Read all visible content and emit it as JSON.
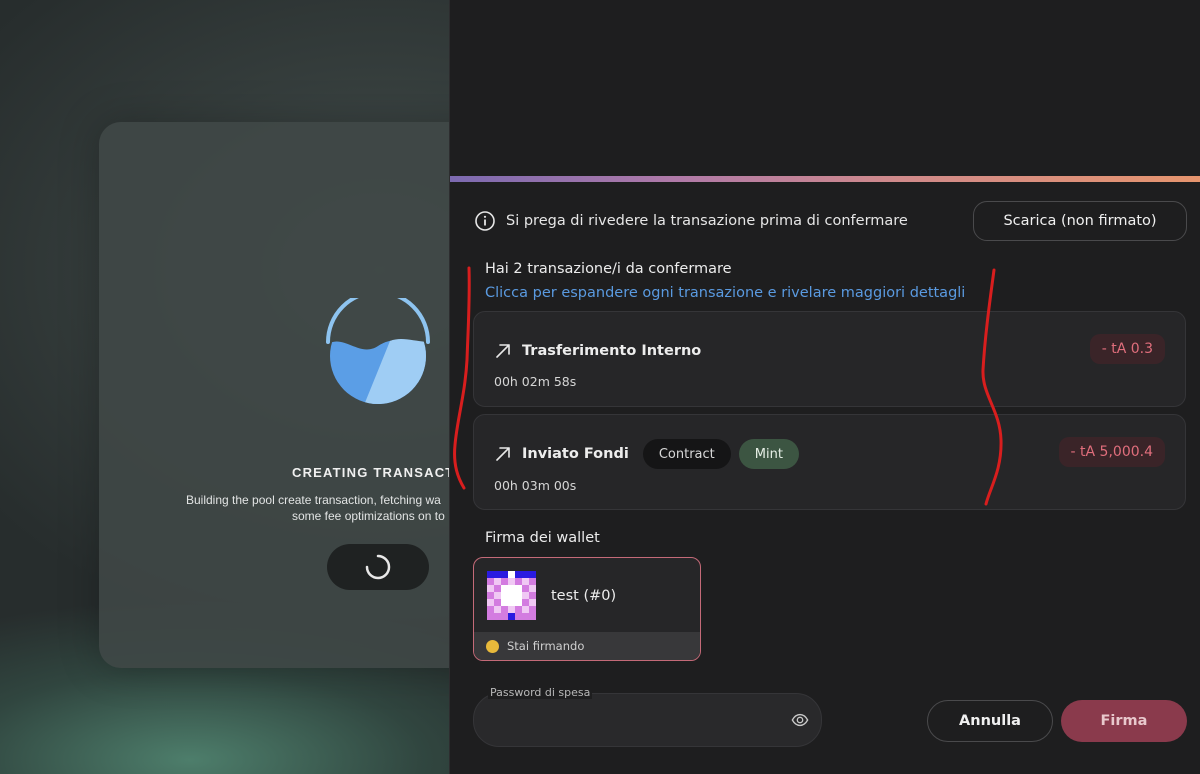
{
  "background_modal": {
    "title": "CREATING TRANSACTIO",
    "description_line1": "Building the pool create transaction, fetching wa",
    "description_line2": "some fee optimizations on to",
    "spinner_icon": "spinner-icon",
    "logo_icon": "water-bowl-logo"
  },
  "review": {
    "info_text": "Si prega di rivedere la transazione prima di confermare",
    "download_label": "Scarica (non firmato)",
    "heading": "Hai 2 transazione/i da confermare",
    "expand_link": "Clicca per espandere ogni transazione e rivelare maggiori dettagli"
  },
  "transactions": [
    {
      "title": "Trasferimento Interno",
      "time": "00h 02m 58s",
      "amount": "- tA 0.3",
      "tags": []
    },
    {
      "title": "Inviato Fondi",
      "time": "00h 03m 00s",
      "amount": "- tA 5,000.4",
      "tags": [
        "Contract",
        "Mint"
      ]
    }
  ],
  "wallets": {
    "section_title": "Firma dei wallet",
    "items": [
      {
        "name": "test (#0)",
        "status": "Stai firmando",
        "status_color": "#e8b93b"
      }
    ]
  },
  "password": {
    "label": "Password di spesa",
    "value": ""
  },
  "actions": {
    "cancel_label": "Annulla",
    "sign_label": "Firma"
  },
  "colors": {
    "accent_link": "#5a9ae0",
    "amount_negative": "#e06e7c",
    "sign_button": "#8a3a4c",
    "wallet_border": "#c46a78"
  }
}
